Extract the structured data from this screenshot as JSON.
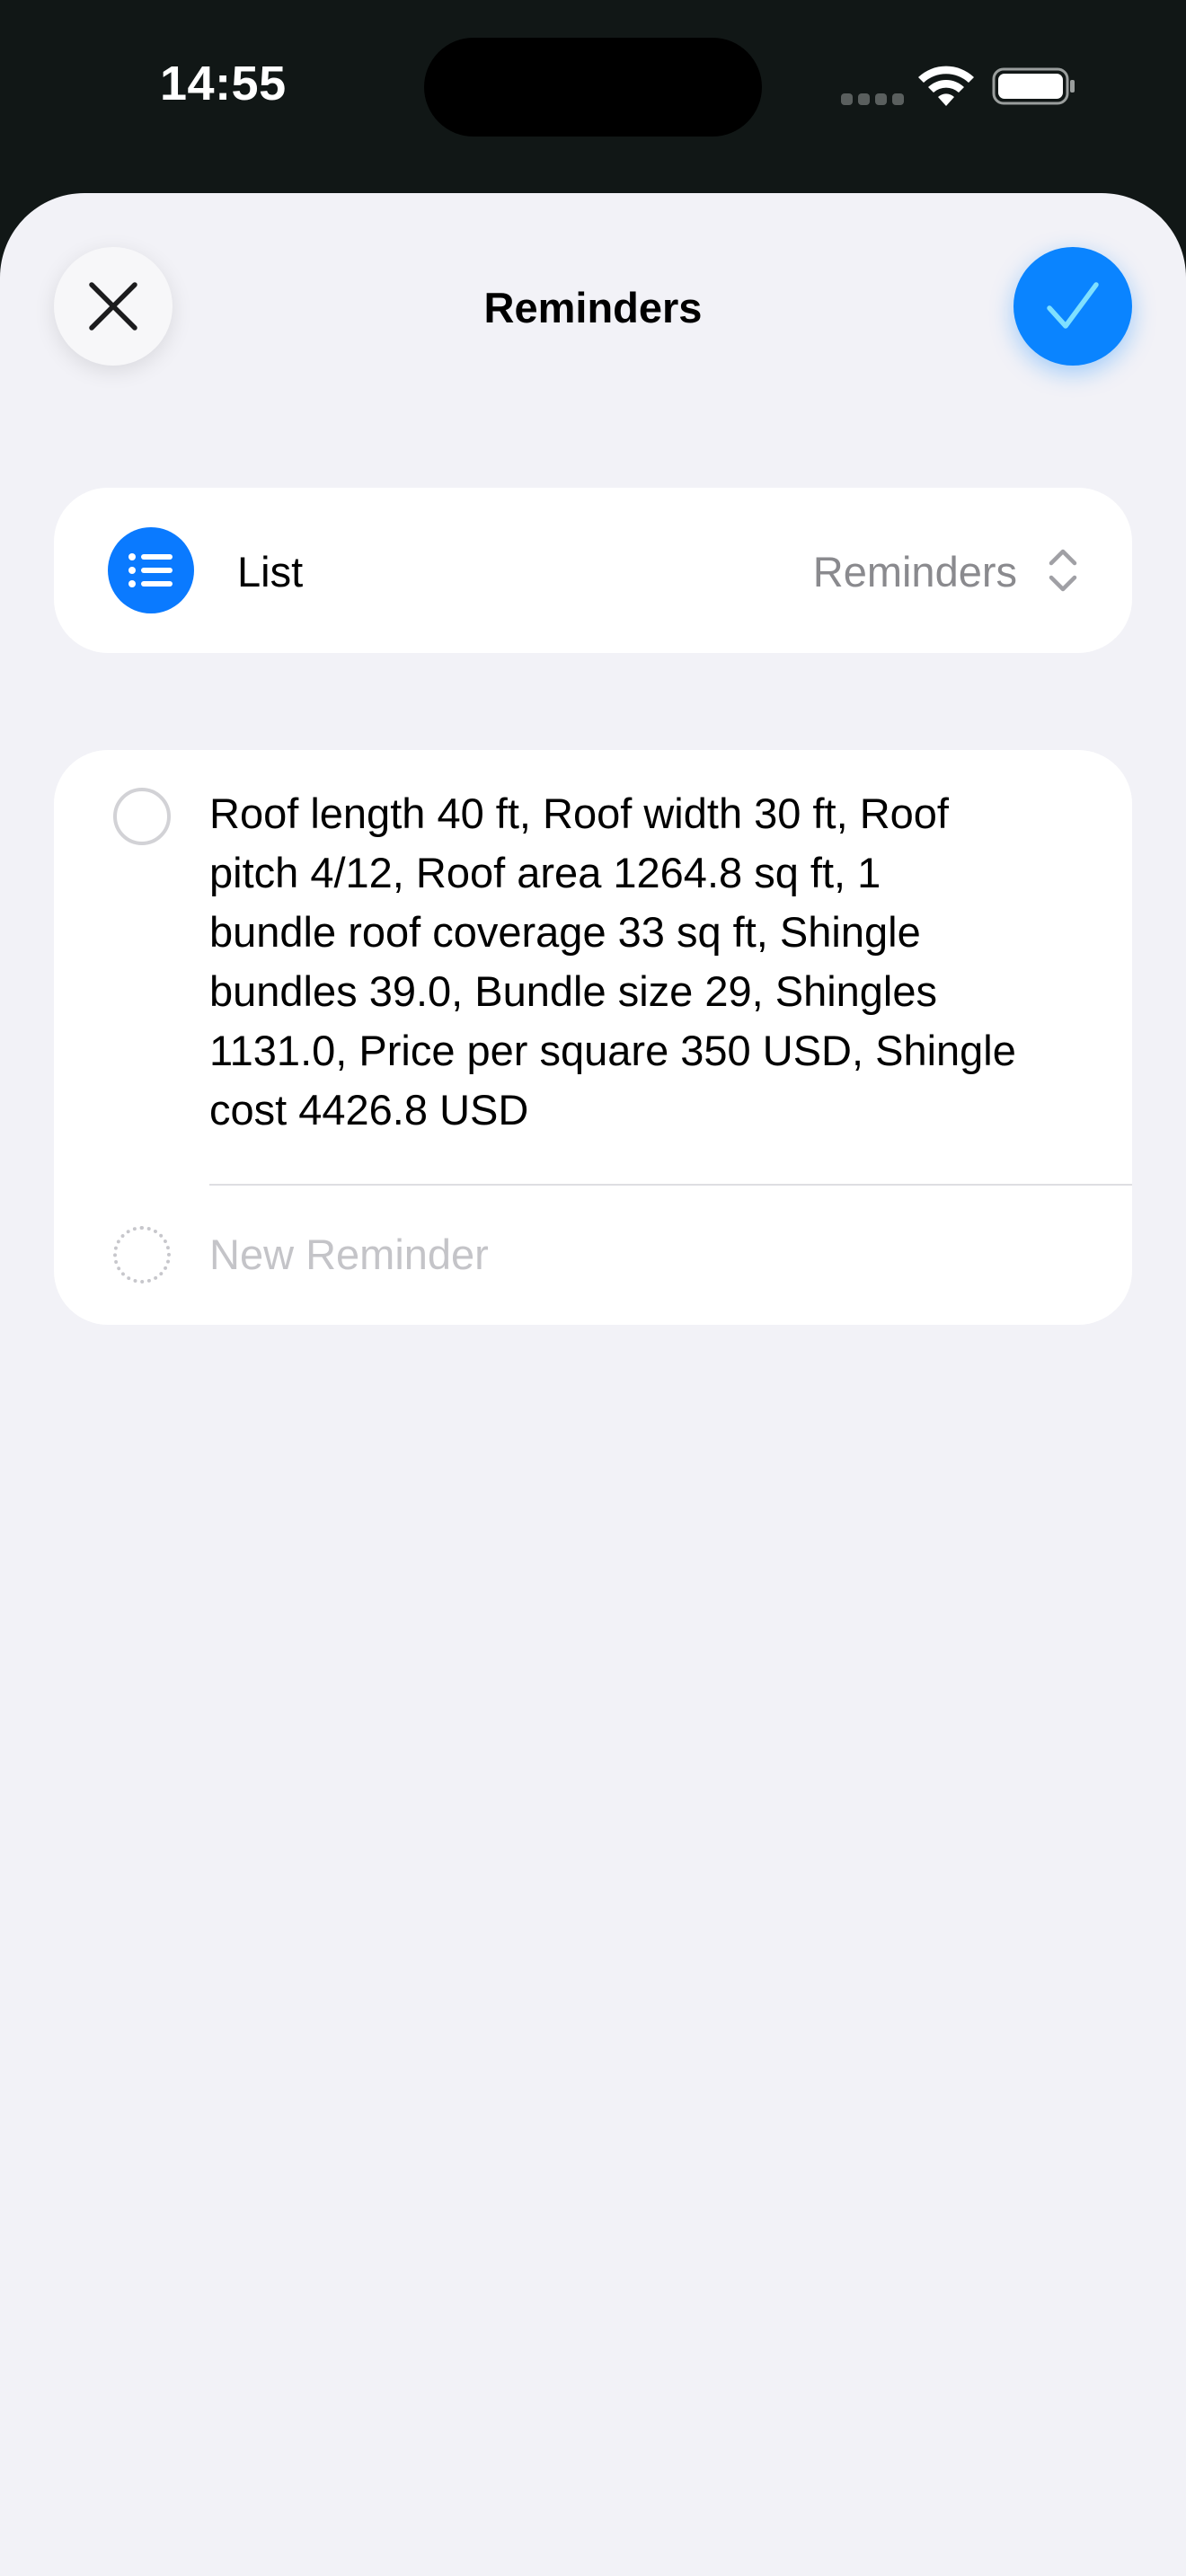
{
  "status_bar": {
    "time": "14:55"
  },
  "header": {
    "title": "Reminders",
    "close_icon": "close-icon",
    "confirm_icon": "checkmark-icon"
  },
  "list_row": {
    "label": "List",
    "value": "Reminders",
    "icon": "list-bullet-icon",
    "chevron_icon": "up-down-chevron-icon"
  },
  "reminders": {
    "items": [
      {
        "text": "Roof length 40 ft, Roof width 30 ft, Roof\npitch  4/12, Roof area 1264.8 sq ft, 1\nbundle roof coverage 33 sq ft, Shingle\nbundles 39.0, Bundle size 29, Shingles\n1131.0, Price per square 350 USD, Shingle\ncost 4426.8 USD",
        "completed": false
      }
    ],
    "new_placeholder": "New Reminder"
  },
  "colors": {
    "accent": "#0a84ff",
    "sheet_background": "#f2f2f7",
    "status_background": "#111716"
  }
}
